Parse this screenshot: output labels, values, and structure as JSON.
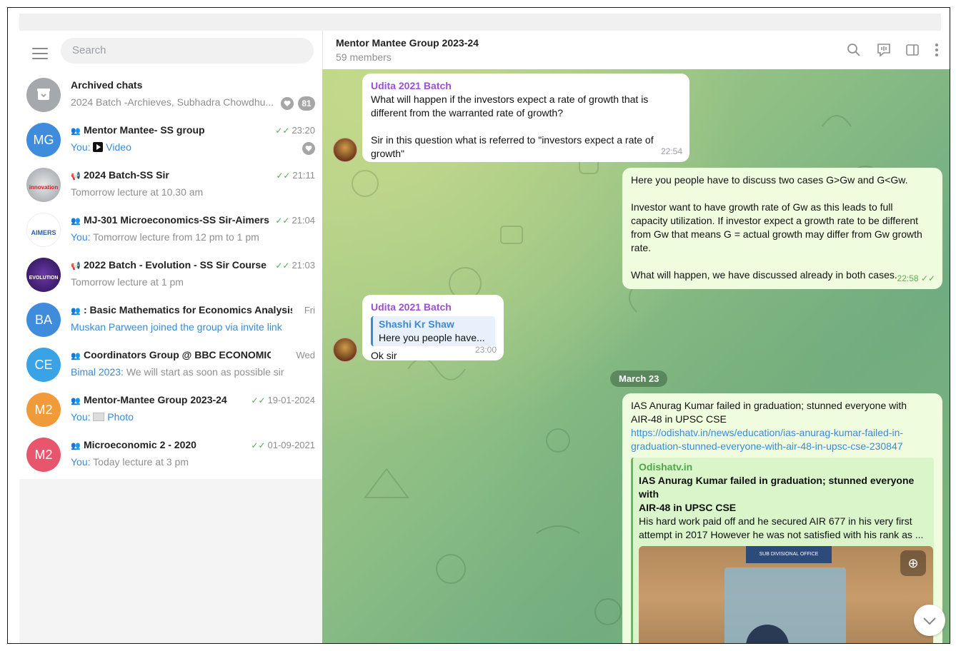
{
  "search": {
    "placeholder": "Search"
  },
  "chats": [
    {
      "title": "Archived chats",
      "subtitle": "2024 Batch -Archieves, Subhadra Chowdhu...",
      "badge": "81",
      "avatar_color": "#a5a9ae",
      "avatar_text": ""
    },
    {
      "title": "Mentor Mantee- SS group",
      "time": "23:20",
      "sender": "You:",
      "preview": "Video",
      "avatar_text": "MG",
      "avatar_color": "#3f8bdc"
    },
    {
      "title": "2024 Batch-SS Sir",
      "time": "21:11",
      "preview": "Tomorrow lecture at 10.30 am",
      "avatar_text": "innovation",
      "avatar_color": "#9aa0a6"
    },
    {
      "title": "MJ-301 Microeconomics-SS Sir-Aimers ...",
      "time": "21:04",
      "sender": "You:",
      "preview": "Tomorrow lecture from 12 pm to 1 pm",
      "avatar_text": "AIMERS",
      "avatar_color": "#ffffff"
    },
    {
      "title": "2022 Batch - Evolution - SS Sir Course",
      "time": "21:03",
      "preview": "Tomorrow lecture at 1 pm",
      "avatar_text": "EVOLUTION",
      "avatar_color": "#4a2a7a"
    },
    {
      "title": ": Basic Mathematics for Economics Analysis",
      "time": "Fri",
      "preview": "Muskan Parween joined the group via invite link",
      "avatar_text": "BA",
      "avatar_color": "#3f8bdc"
    },
    {
      "title": "Coordinators Group @ BBC ECONOMICS",
      "time": "Wed",
      "sender": "Bimal 2023:",
      "preview": "We will start as soon as possible sir",
      "avatar_text": "CE",
      "avatar_color": "#3aa3e6"
    },
    {
      "title": "Mentor-Mantee Group 2023-24",
      "time": "19-01-2024",
      "sender": "You:",
      "preview": "Photo",
      "avatar_text": "M2",
      "avatar_color": "#f09a3a"
    },
    {
      "title": "Microeconomic 2 - 2020",
      "time": "01-09-2021",
      "sender": "You:",
      "preview": "Today lecture at 3 pm",
      "avatar_text": "M2",
      "avatar_color": "#e8566d"
    }
  ],
  "header": {
    "title": "Mentor Mantee Group 2023-24",
    "members": "59 members"
  },
  "messages": {
    "m1": {
      "sender": "Udita 2021 Batch",
      "line1": "What will happen if the investors expect a rate of growth that is",
      "line2": "different from the warranted rate of growth?",
      "line3": "Sir in this question what is referred to \"investors expect a rate of",
      "line4": "growth\"",
      "time": "22:54"
    },
    "m2": {
      "p1": "Here you people have to discuss two cases G>Gw and G<Gw.",
      "p2a": "Investor want to have growth rate of Gw as this leads to full",
      "p2b": "capacity utilization. If investor expect a growth rate to be different",
      "p2c": "from Gw that means G = actual growth may differ from Gw growth",
      "p2d": "rate.",
      "p3": "What will happen, we have discussed already in both cases.",
      "time": "22:58"
    },
    "m3": {
      "sender": "Udita 2021 Batch",
      "reply_name": "Shashi Kr Shaw",
      "reply_text": "Here you people have...",
      "text": "Ok sir",
      "time": "23:00"
    },
    "date": "March 23",
    "m4": {
      "line1": "IAS Anurag Kumar failed in graduation; stunned everyone with",
      "line2": "AIR-48 in UPSC CSE",
      "url1": "https://odishatv.in/news/education/ias-anurag-kumar-failed-in-",
      "url2": "graduation-stunned-everyone-with-air-48-in-upsc-cse-230847",
      "site": "Odishatv.in",
      "pv_title1": "IAS Anurag Kumar failed in graduation; stunned everyone with",
      "pv_title2": "AIR-48 in UPSC CSE",
      "pv_desc1": "His hard work paid off and he secured AIR 677 in his very first",
      "pv_desc2": "attempt in 2017 However he was not satisfied with his rank as ...",
      "office_sign": "SUB DIVISIONAL OFFICE"
    }
  }
}
